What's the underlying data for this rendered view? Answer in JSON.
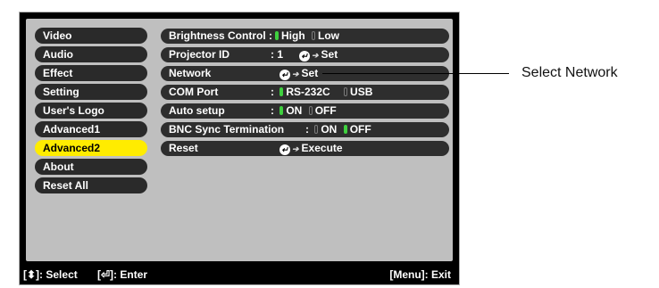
{
  "menu": [
    {
      "label": "Video"
    },
    {
      "label": "Audio"
    },
    {
      "label": "Effect"
    },
    {
      "label": "Setting"
    },
    {
      "label": "User's Logo"
    },
    {
      "label": "Advanced1"
    },
    {
      "label": "Advanced2",
      "active": true
    },
    {
      "label": "About"
    },
    {
      "label": "Reset All"
    }
  ],
  "settings": {
    "brightness": {
      "label": "Brightness Control :",
      "opt1": "High",
      "opt2": "Low",
      "selected": "High"
    },
    "projector_id": {
      "label": "Projector ID",
      "value": ": 1",
      "action": "Set"
    },
    "network": {
      "label": "Network",
      "action": "Set"
    },
    "com_port": {
      "label": "COM Port",
      "colon": ":",
      "opt1": "RS-232C",
      "opt2": "USB",
      "selected": "RS-232C"
    },
    "auto_setup": {
      "label": "Auto setup",
      "colon": ":",
      "opt1": "ON",
      "opt2": "OFF",
      "selected": "ON"
    },
    "bnc_sync": {
      "label": "BNC Sync Termination",
      "colon": ":",
      "opt1": "ON",
      "opt2": "OFF",
      "selected": "OFF"
    },
    "reset": {
      "label": "Reset",
      "action": "Execute"
    }
  },
  "footer": {
    "select_hint": "[⬍]: Select",
    "enter_hint": "[⏎]: Enter",
    "exit_hint": "[Menu]: Exit"
  },
  "callout": {
    "text": "Select Network"
  },
  "colors": {
    "active_menu": "#ffec00",
    "indicator_on": "#3fd13f",
    "row_bg": "#2e2e2e",
    "panel_bg": "#bfbfbf"
  }
}
